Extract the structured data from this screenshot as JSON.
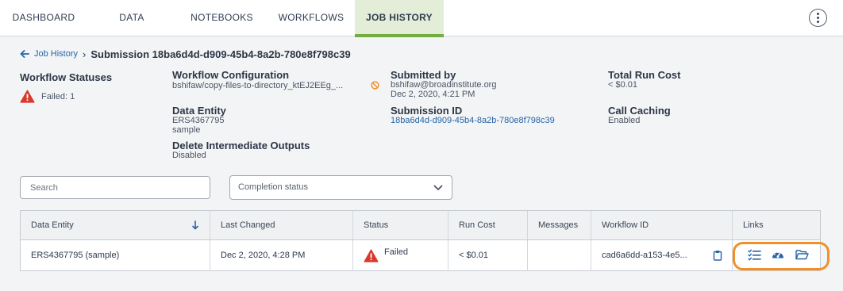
{
  "nav": {
    "tabs": [
      "DASHBOARD",
      "DATA",
      "NOTEBOOKS",
      "WORKFLOWS",
      "JOB HISTORY"
    ],
    "active_tab": "JOB HISTORY"
  },
  "breadcrumb": {
    "back_label": "Job History",
    "separator": "›",
    "title": "Submission 18ba6d4d-d909-45b4-8a2b-780e8f798c39"
  },
  "info": {
    "workflow_statuses": {
      "label": "Workflow Statuses",
      "failed_text": "Failed: 1"
    },
    "workflow_configuration": {
      "label": "Workflow Configuration",
      "value": "bshifaw/copy-files-to-directory_ktEJ2EEg_..."
    },
    "submitted_by": {
      "label": "Submitted by",
      "email": "bshifaw@broadinstitute.org",
      "date": "Dec 2, 2020, 4:21 PM"
    },
    "total_run_cost": {
      "label": "Total Run Cost",
      "value": "< $0.01"
    },
    "data_entity": {
      "label": "Data Entity",
      "id": "ERS4367795",
      "type": "sample"
    },
    "submission_id": {
      "label": "Submission ID",
      "value": "18ba6d4d-d909-45b4-8a2b-780e8f798c39"
    },
    "call_caching": {
      "label": "Call Caching",
      "value": "Enabled"
    },
    "delete_intermediate": {
      "label": "Delete Intermediate Outputs",
      "value": "Disabled"
    }
  },
  "filters": {
    "search_placeholder": "Search",
    "completion_status_placeholder": "Completion status"
  },
  "table": {
    "headers": [
      "Data Entity",
      "Last Changed",
      "Status",
      "Run Cost",
      "Messages",
      "Workflow ID",
      "Links"
    ],
    "rows": [
      {
        "data_entity": "ERS4367795 (sample)",
        "last_changed": "Dec 2, 2020, 4:28 PM",
        "status": "Failed",
        "run_cost": "< $0.01",
        "messages": "",
        "workflow_id": "cad6a6dd-a153-4e5..."
      }
    ]
  },
  "colors": {
    "accent_green": "#74ae43",
    "link_blue": "#2765a8",
    "warning_red": "#d9392b",
    "highlight_orange": "#f0902b"
  },
  "icons": [
    "kebab-menu-icon",
    "back-arrow-icon",
    "warning-icon",
    "disabled-icon",
    "chevron-down-icon",
    "sort-down-icon",
    "clipboard-icon",
    "task-list-icon",
    "dashboard-gauge-icon",
    "folder-open-icon"
  ]
}
